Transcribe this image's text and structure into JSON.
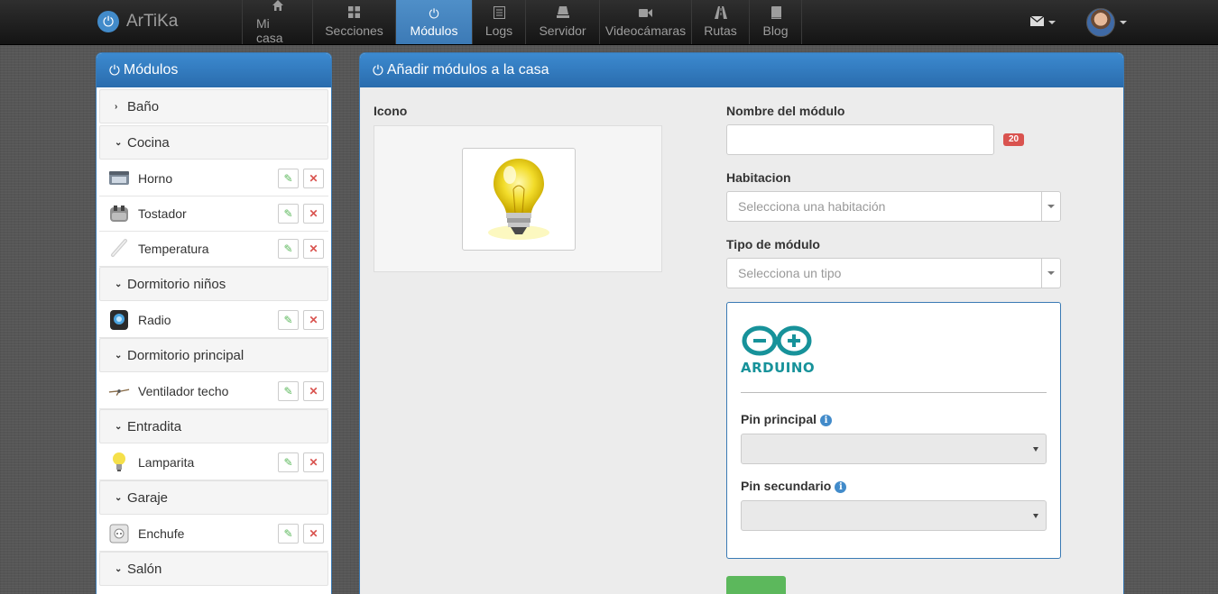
{
  "brand": {
    "name": "ArTiKa"
  },
  "nav": {
    "items": [
      {
        "label": "Mi casa",
        "icon": "home-icon"
      },
      {
        "label": "Secciones",
        "icon": "grid-icon"
      },
      {
        "label": "Módulos",
        "icon": "power-icon",
        "active": true
      },
      {
        "label": "Logs",
        "icon": "list-icon"
      },
      {
        "label": "Servidor",
        "icon": "hdd-icon"
      },
      {
        "label": "Videocámaras",
        "icon": "camera-icon"
      },
      {
        "label": "Rutas",
        "icon": "road-icon"
      },
      {
        "label": "Blog",
        "icon": "book-icon"
      }
    ]
  },
  "sidebar": {
    "title": "Módulos",
    "groups": [
      {
        "name": "Baño",
        "expanded": false,
        "items": []
      },
      {
        "name": "Cocina",
        "expanded": true,
        "items": [
          {
            "name": "Horno",
            "icon": "oven-icon"
          },
          {
            "name": "Tostador",
            "icon": "toaster-icon"
          },
          {
            "name": "Temperatura",
            "icon": "thermometer-icon"
          }
        ]
      },
      {
        "name": "Dormitorio niños",
        "expanded": true,
        "items": [
          {
            "name": "Radio",
            "icon": "radio-icon"
          }
        ]
      },
      {
        "name": "Dormitorio principal",
        "expanded": true,
        "items": [
          {
            "name": "Ventilador techo",
            "icon": "ceiling-fan-icon"
          }
        ]
      },
      {
        "name": "Entradita",
        "expanded": true,
        "items": [
          {
            "name": "Lamparita",
            "icon": "lamp-icon"
          }
        ]
      },
      {
        "name": "Garaje",
        "expanded": true,
        "items": [
          {
            "name": "Enchufe",
            "icon": "socket-icon"
          }
        ]
      },
      {
        "name": "Salón",
        "expanded": true,
        "items": []
      }
    ]
  },
  "main": {
    "title": "Añadir módulos a la casa",
    "icon_label": "Icono",
    "name_label": "Nombre del módulo",
    "name_value": "",
    "name_counter": "20",
    "room_label": "Habitacion",
    "room_placeholder": "Selecciona una habitación",
    "type_label": "Tipo de módulo",
    "type_placeholder": "Selecciona un tipo",
    "arduino": {
      "logo_text": "ARDUINO",
      "pin_main_label": "Pin principal",
      "pin_secondary_label": "Pin secundario",
      "pin_main_value": "",
      "pin_secondary_value": ""
    }
  },
  "colors": {
    "accent": "#3c8ad0",
    "danger": "#d9534f",
    "success": "#5cb85c",
    "arduino": "#17929a"
  }
}
